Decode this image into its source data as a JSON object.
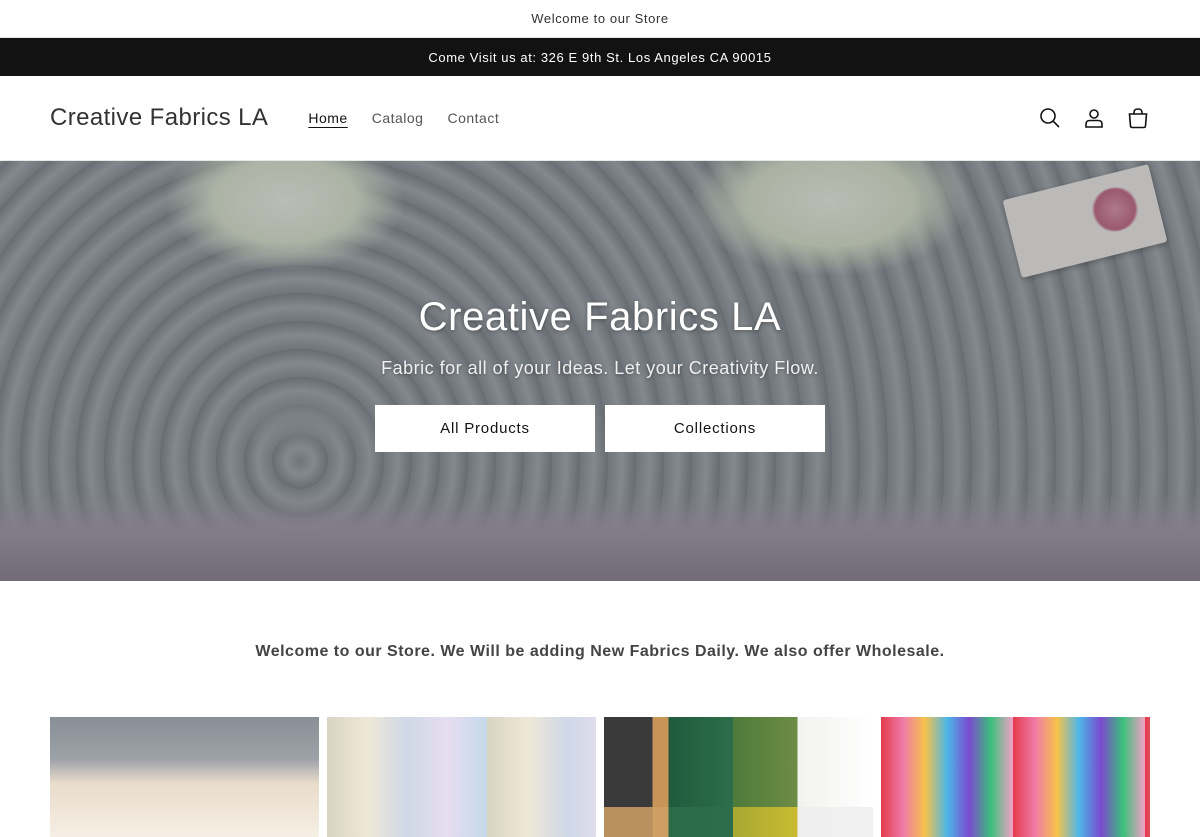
{
  "announcements": {
    "top": "Welcome to our Store",
    "address": "Come Visit us at: 326 E 9th St. Los Angeles CA 90015"
  },
  "header": {
    "logo": "Creative Fabrics LA",
    "nav": [
      {
        "label": "Home",
        "active": true
      },
      {
        "label": "Catalog",
        "active": false
      },
      {
        "label": "Contact",
        "active": false
      }
    ],
    "icons": [
      "search-icon",
      "account-icon",
      "cart-icon"
    ]
  },
  "hero": {
    "title": "Creative Fabrics LA",
    "subtitle": "Fabric for all of your Ideas. Let your Creativity Flow.",
    "buttons": [
      "All Products",
      "Collections"
    ]
  },
  "welcome_text": "Welcome to our Store. We Will be adding New Fabrics Daily. We also offer Wholesale.",
  "colors": {
    "dark_bar": "#121212",
    "text": "#121212",
    "button_bg": "#ffffff"
  }
}
